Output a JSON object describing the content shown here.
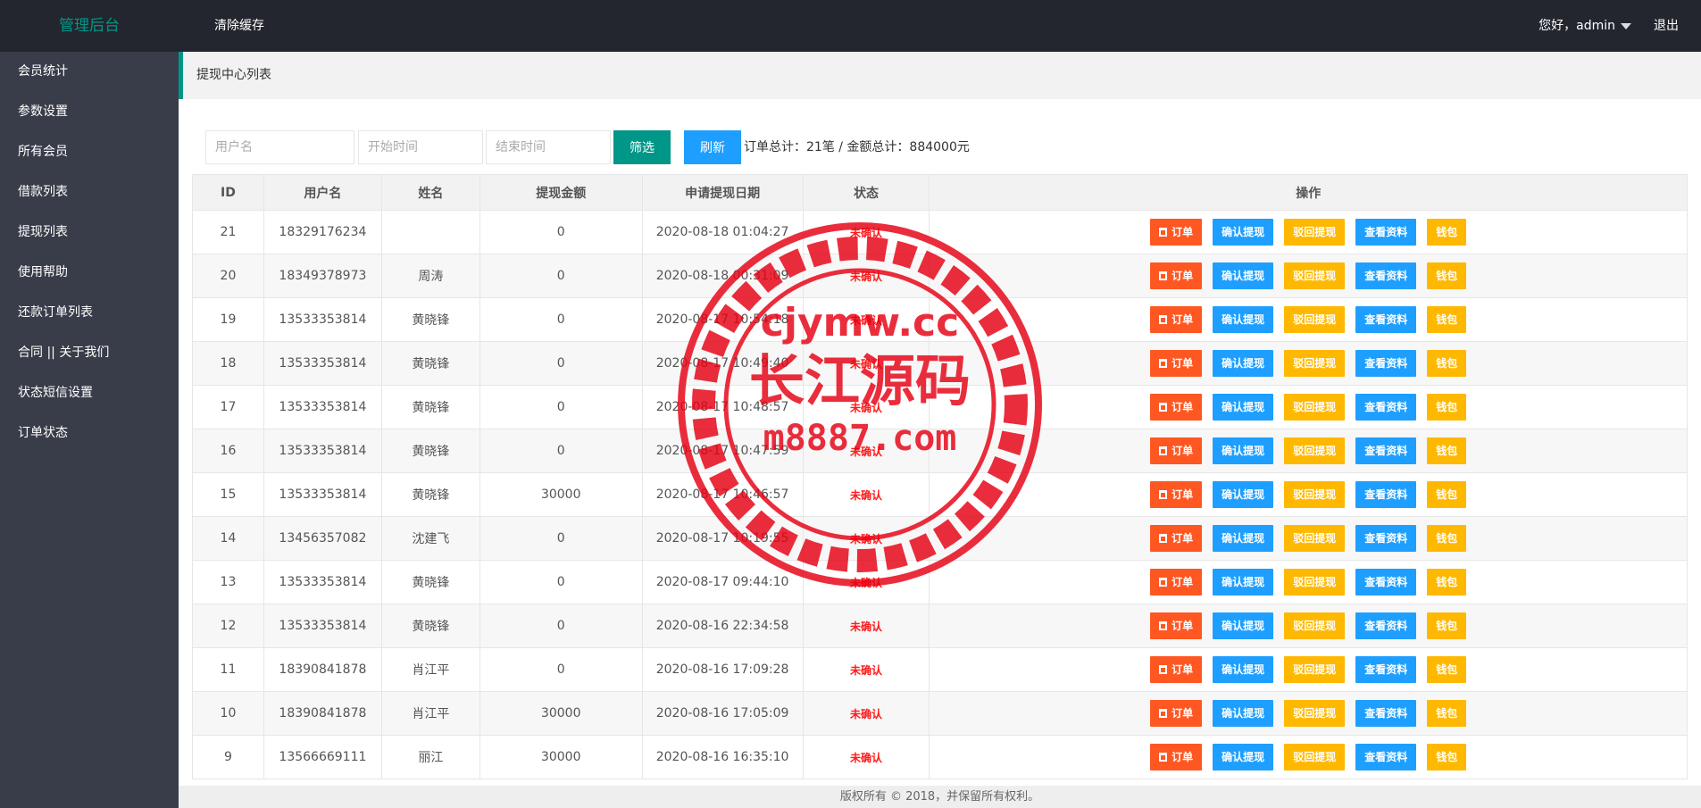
{
  "header": {
    "logo": "管理后台",
    "clear_cache": "清除缓存",
    "user": "您好，admin",
    "logout": "退出"
  },
  "sidebar": {
    "items": [
      {
        "label": "会员统计"
      },
      {
        "label": "参数设置"
      },
      {
        "label": "所有会员"
      },
      {
        "label": "借款列表"
      },
      {
        "label": "提现列表"
      },
      {
        "label": "使用帮助"
      },
      {
        "label": "还款订单列表"
      },
      {
        "label": "合同 || 关于我们"
      },
      {
        "label": "状态短信设置"
      },
      {
        "label": "订单状态"
      }
    ]
  },
  "breadcrumb": "提现中心列表",
  "filter": {
    "username_placeholder": "用户名",
    "start_placeholder": "开始时间",
    "end_placeholder": "结束时间",
    "filter_label": "筛选",
    "refresh_label": "刷新",
    "total_text": "订单总计：21笔 / 金额总计：884000元"
  },
  "table": {
    "headers": [
      "ID",
      "用户名",
      "姓名",
      "提现金额",
      "申请提现日期",
      "状态",
      "操作"
    ],
    "actions": {
      "order": "订单",
      "confirm": "确认提现",
      "reject": "驳回提现",
      "view": "查看资料",
      "wallet": "钱包"
    },
    "rows": [
      {
        "id": "21",
        "username": "18329176234",
        "name": "",
        "amount": "0",
        "date": "2020-08-18 01:04:27",
        "status": "未确认"
      },
      {
        "id": "20",
        "username": "18349378973",
        "name": "周涛",
        "amount": "0",
        "date": "2020-08-18 00:31:09",
        "status": "未确认"
      },
      {
        "id": "19",
        "username": "13533353814",
        "name": "黄晓锋",
        "amount": "0",
        "date": "2020-08-17 10:54:18",
        "status": "未确认"
      },
      {
        "id": "18",
        "username": "13533353814",
        "name": "黄晓锋",
        "amount": "0",
        "date": "2020-08-17 10:49:40",
        "status": "未确认"
      },
      {
        "id": "17",
        "username": "13533353814",
        "name": "黄晓锋",
        "amount": "0",
        "date": "2020-08-17 10:48:57",
        "status": "未确认"
      },
      {
        "id": "16",
        "username": "13533353814",
        "name": "黄晓锋",
        "amount": "0",
        "date": "2020-08-17 10:47:59",
        "status": "未确认"
      },
      {
        "id": "15",
        "username": "13533353814",
        "name": "黄晓锋",
        "amount": "30000",
        "date": "2020-08-17 10:46:57",
        "status": "未确认"
      },
      {
        "id": "14",
        "username": "13456357082",
        "name": "沈建飞",
        "amount": "0",
        "date": "2020-08-17 10:19:55",
        "status": "未确认"
      },
      {
        "id": "13",
        "username": "13533353814",
        "name": "黄晓锋",
        "amount": "0",
        "date": "2020-08-17 09:44:10",
        "status": "未确认"
      },
      {
        "id": "12",
        "username": "13533353814",
        "name": "黄晓锋",
        "amount": "0",
        "date": "2020-08-16 22:34:58",
        "status": "未确认"
      },
      {
        "id": "11",
        "username": "18390841878",
        "name": "肖江平",
        "amount": "0",
        "date": "2020-08-16 17:09:28",
        "status": "未确认"
      },
      {
        "id": "10",
        "username": "18390841878",
        "name": "肖江平",
        "amount": "30000",
        "date": "2020-08-16 17:05:09",
        "status": "未确认"
      },
      {
        "id": "9",
        "username": "13566669111",
        "name": "丽江",
        "amount": "30000",
        "date": "2020-08-16 16:35:10",
        "status": "未确认"
      }
    ]
  },
  "footer": "版权所有 © 2018，并保留所有权利。",
  "watermark": {
    "line1": "cjymw.cc",
    "line2": "长江源码",
    "line3": "m8887.com"
  },
  "colors": {
    "header_bg": "#23262e",
    "sidebar_bg": "#393d49",
    "accent": "#009688",
    "blue": "#1e9fff",
    "orange": "#ff5722",
    "yellow": "#ffb800",
    "status_red": "#ff1a1a"
  }
}
